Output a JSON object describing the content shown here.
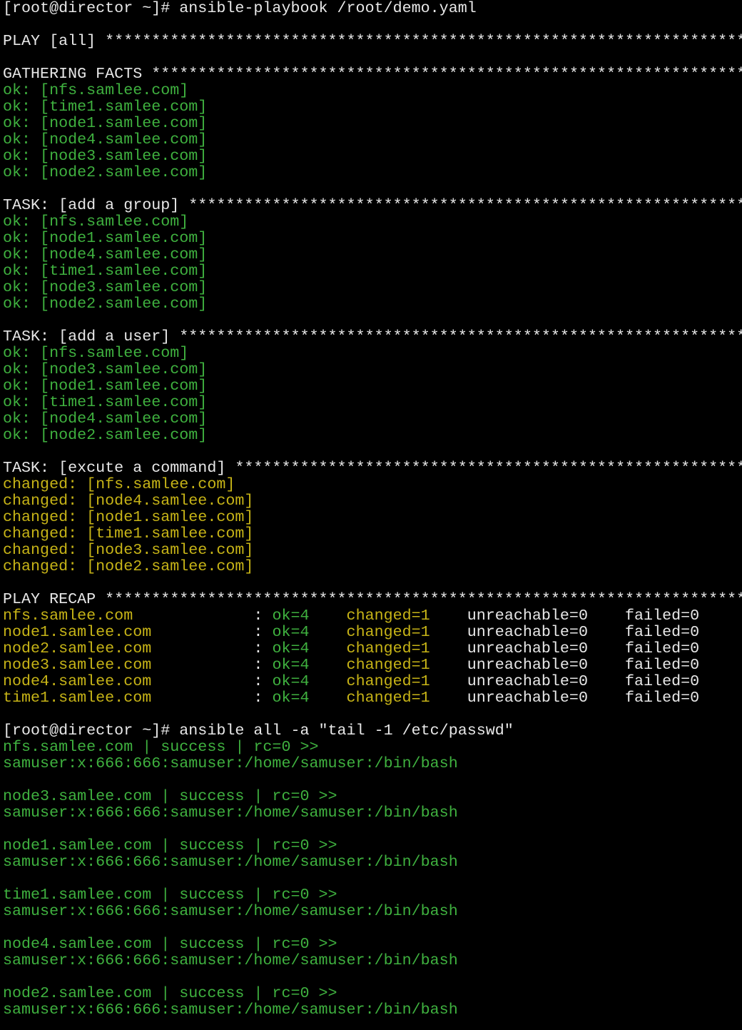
{
  "colors": {
    "background": "#000000",
    "default_text": "#e8e8e8",
    "ok_green": "#3fb13f",
    "changed_yellow": "#c7b417"
  },
  "lines": [
    {
      "segments": [
        {
          "t": "[root@director ~]# ansible-playbook /root/demo.yaml",
          "c": "w"
        }
      ]
    },
    {
      "segments": []
    },
    {
      "segments": [
        {
          "t": "PLAY [all] ***********************************************************************",
          "c": "w"
        }
      ]
    },
    {
      "segments": []
    },
    {
      "segments": [
        {
          "t": "GATHERING FACTS ******************************************************************",
          "c": "w"
        }
      ]
    },
    {
      "segments": [
        {
          "t": "ok: [nfs.samlee.com]",
          "c": "g"
        }
      ]
    },
    {
      "segments": [
        {
          "t": "ok: [time1.samlee.com]",
          "c": "g"
        }
      ]
    },
    {
      "segments": [
        {
          "t": "ok: [node1.samlee.com]",
          "c": "g"
        }
      ]
    },
    {
      "segments": [
        {
          "t": "ok: [node4.samlee.com]",
          "c": "g"
        }
      ]
    },
    {
      "segments": [
        {
          "t": "ok: [node3.samlee.com]",
          "c": "g"
        }
      ]
    },
    {
      "segments": [
        {
          "t": "ok: [node2.samlee.com]",
          "c": "g"
        }
      ]
    },
    {
      "segments": []
    },
    {
      "segments": [
        {
          "t": "TASK: [add a group] **************************************************************",
          "c": "w"
        }
      ]
    },
    {
      "segments": [
        {
          "t": "ok: [nfs.samlee.com]",
          "c": "g"
        }
      ]
    },
    {
      "segments": [
        {
          "t": "ok: [node1.samlee.com]",
          "c": "g"
        }
      ]
    },
    {
      "segments": [
        {
          "t": "ok: [node4.samlee.com]",
          "c": "g"
        }
      ]
    },
    {
      "segments": [
        {
          "t": "ok: [time1.samlee.com]",
          "c": "g"
        }
      ]
    },
    {
      "segments": [
        {
          "t": "ok: [node3.samlee.com]",
          "c": "g"
        }
      ]
    },
    {
      "segments": [
        {
          "t": "ok: [node2.samlee.com]",
          "c": "g"
        }
      ]
    },
    {
      "segments": []
    },
    {
      "segments": [
        {
          "t": "TASK: [add a user] ***************************************************************",
          "c": "w"
        }
      ]
    },
    {
      "segments": [
        {
          "t": "ok: [nfs.samlee.com]",
          "c": "g"
        }
      ]
    },
    {
      "segments": [
        {
          "t": "ok: [node3.samlee.com]",
          "c": "g"
        }
      ]
    },
    {
      "segments": [
        {
          "t": "ok: [node1.samlee.com]",
          "c": "g"
        }
      ]
    },
    {
      "segments": [
        {
          "t": "ok: [time1.samlee.com]",
          "c": "g"
        }
      ]
    },
    {
      "segments": [
        {
          "t": "ok: [node4.samlee.com]",
          "c": "g"
        }
      ]
    },
    {
      "segments": [
        {
          "t": "ok: [node2.samlee.com]",
          "c": "g"
        }
      ]
    },
    {
      "segments": []
    },
    {
      "segments": [
        {
          "t": "TASK: [excute a command] *********************************************************",
          "c": "w"
        }
      ]
    },
    {
      "segments": [
        {
          "t": "changed: [nfs.samlee.com]",
          "c": "y"
        }
      ]
    },
    {
      "segments": [
        {
          "t": "changed: [node4.samlee.com]",
          "c": "y"
        }
      ]
    },
    {
      "segments": [
        {
          "t": "changed: [node1.samlee.com]",
          "c": "y"
        }
      ]
    },
    {
      "segments": [
        {
          "t": "changed: [time1.samlee.com]",
          "c": "y"
        }
      ]
    },
    {
      "segments": [
        {
          "t": "changed: [node3.samlee.com]",
          "c": "y"
        }
      ]
    },
    {
      "segments": [
        {
          "t": "changed: [node2.samlee.com]",
          "c": "y"
        }
      ]
    },
    {
      "segments": []
    },
    {
      "segments": [
        {
          "t": "PLAY RECAP ***********************************************************************",
          "c": "w"
        }
      ]
    },
    {
      "segments": [
        {
          "t": "nfs.samlee.com            ",
          "c": "y"
        },
        {
          "t": " : ",
          "c": "w"
        },
        {
          "t": "ok=4   ",
          "c": "g"
        },
        {
          "t": " changed=1   ",
          "c": "y"
        },
        {
          "t": " unreachable=0    failed=0",
          "c": "w"
        }
      ]
    },
    {
      "segments": [
        {
          "t": "node1.samlee.com          ",
          "c": "y"
        },
        {
          "t": " : ",
          "c": "w"
        },
        {
          "t": "ok=4   ",
          "c": "g"
        },
        {
          "t": " changed=1   ",
          "c": "y"
        },
        {
          "t": " unreachable=0    failed=0",
          "c": "w"
        }
      ]
    },
    {
      "segments": [
        {
          "t": "node2.samlee.com          ",
          "c": "y"
        },
        {
          "t": " : ",
          "c": "w"
        },
        {
          "t": "ok=4   ",
          "c": "g"
        },
        {
          "t": " changed=1   ",
          "c": "y"
        },
        {
          "t": " unreachable=0    failed=0",
          "c": "w"
        }
      ]
    },
    {
      "segments": [
        {
          "t": "node3.samlee.com          ",
          "c": "y"
        },
        {
          "t": " : ",
          "c": "w"
        },
        {
          "t": "ok=4   ",
          "c": "g"
        },
        {
          "t": " changed=1   ",
          "c": "y"
        },
        {
          "t": " unreachable=0    failed=0",
          "c": "w"
        }
      ]
    },
    {
      "segments": [
        {
          "t": "node4.samlee.com          ",
          "c": "y"
        },
        {
          "t": " : ",
          "c": "w"
        },
        {
          "t": "ok=4   ",
          "c": "g"
        },
        {
          "t": " changed=1   ",
          "c": "y"
        },
        {
          "t": " unreachable=0    failed=0",
          "c": "w"
        }
      ]
    },
    {
      "segments": [
        {
          "t": "time1.samlee.com          ",
          "c": "y"
        },
        {
          "t": " : ",
          "c": "w"
        },
        {
          "t": "ok=4   ",
          "c": "g"
        },
        {
          "t": " changed=1   ",
          "c": "y"
        },
        {
          "t": " unreachable=0    failed=0",
          "c": "w"
        }
      ]
    },
    {
      "segments": []
    },
    {
      "segments": [
        {
          "t": "[root@director ~]# ansible all -a \"tail -1 /etc/passwd\"",
          "c": "w"
        }
      ]
    },
    {
      "segments": [
        {
          "t": "nfs.samlee.com | success | rc=0 >>",
          "c": "g"
        }
      ]
    },
    {
      "segments": [
        {
          "t": "samuser:x:666:666:samuser:/home/samuser:/bin/bash",
          "c": "g"
        }
      ]
    },
    {
      "segments": []
    },
    {
      "segments": [
        {
          "t": "node3.samlee.com | success | rc=0 >>",
          "c": "g"
        }
      ]
    },
    {
      "segments": [
        {
          "t": "samuser:x:666:666:samuser:/home/samuser:/bin/bash",
          "c": "g"
        }
      ]
    },
    {
      "segments": []
    },
    {
      "segments": [
        {
          "t": "node1.samlee.com | success | rc=0 >>",
          "c": "g"
        }
      ]
    },
    {
      "segments": [
        {
          "t": "samuser:x:666:666:samuser:/home/samuser:/bin/bash",
          "c": "g"
        }
      ]
    },
    {
      "segments": []
    },
    {
      "segments": [
        {
          "t": "time1.samlee.com | success | rc=0 >>",
          "c": "g"
        }
      ]
    },
    {
      "segments": [
        {
          "t": "samuser:x:666:666:samuser:/home/samuser:/bin/bash",
          "c": "g"
        }
      ]
    },
    {
      "segments": []
    },
    {
      "segments": [
        {
          "t": "node4.samlee.com | success | rc=0 >>",
          "c": "g"
        }
      ]
    },
    {
      "segments": [
        {
          "t": "samuser:x:666:666:samuser:/home/samuser:/bin/bash",
          "c": "g"
        }
      ]
    },
    {
      "segments": []
    },
    {
      "segments": [
        {
          "t": "node2.samlee.com | success | rc=0 >>",
          "c": "g"
        }
      ]
    },
    {
      "segments": [
        {
          "t": "samuser:x:666:666:samuser:/home/samuser:/bin/bash",
          "c": "g"
        }
      ]
    }
  ]
}
